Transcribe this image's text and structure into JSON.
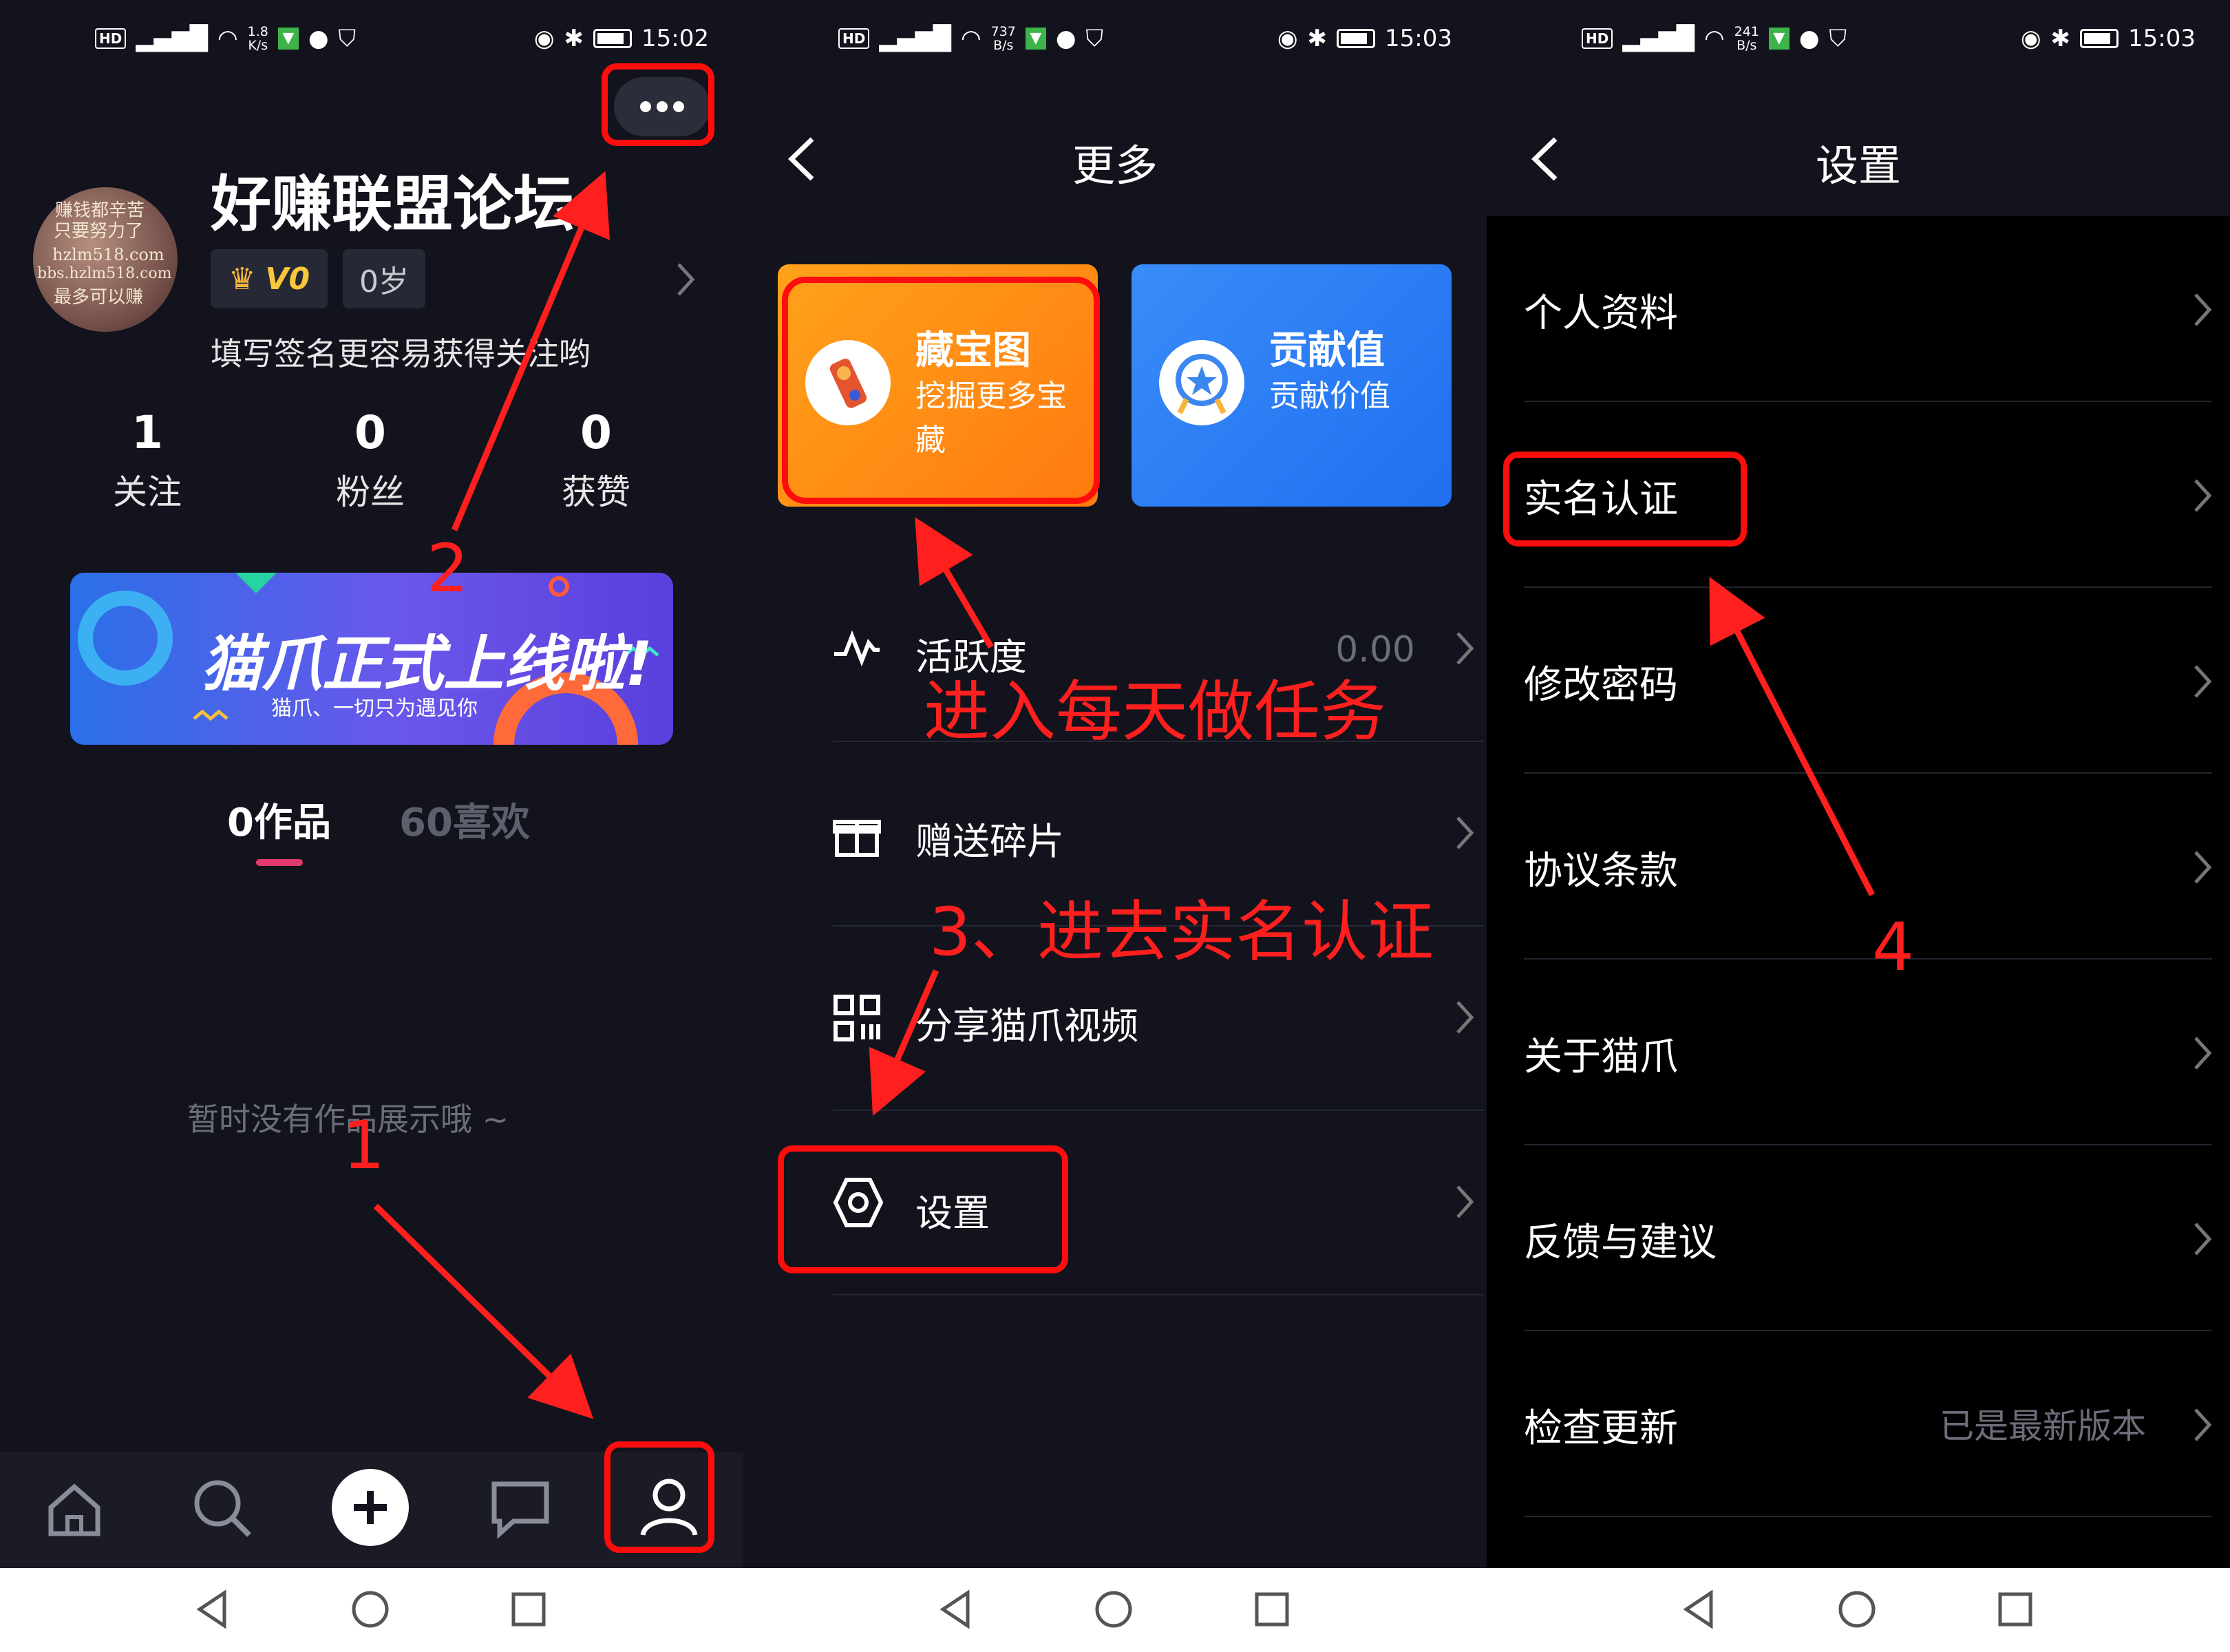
{
  "panel1": {
    "status": {
      "speed_top": "1.8",
      "speed_unit": "K/s",
      "time": "15:02"
    },
    "profile": {
      "name": "好赚联盟论坛",
      "level": "V0",
      "age": "0岁",
      "signature": "填写签名更容易获得关注哟",
      "avatar_text": [
        "赚钱都辛苦",
        "只要努力了",
        "hzlm518.com",
        "bbs.hzlm518.com",
        "最多可以赚"
      ]
    },
    "stats": [
      {
        "value": "1",
        "label": "关注"
      },
      {
        "value": "0",
        "label": "粉丝"
      },
      {
        "value": "0",
        "label": "获赞"
      }
    ],
    "banner": {
      "title": "猫爪正式上线啦!",
      "subtitle": "猫爪、一切只为遇见你"
    },
    "tabs": {
      "works": "0作品",
      "likes": "60喜欢"
    },
    "empty_text": "暂时没有作品展示哦 ~",
    "annotations": {
      "step1": "1",
      "step2": "2"
    }
  },
  "panel2": {
    "status": {
      "speed_top": "737",
      "speed_unit": "B/s",
      "time": "15:03"
    },
    "title": "更多",
    "cards": [
      {
        "title": "藏宝图",
        "subtitle": "挖掘更多宝藏"
      },
      {
        "title": "贡献值",
        "subtitle": "贡献价值"
      }
    ],
    "rows": [
      {
        "label": "活跃度",
        "value": "0.00"
      },
      {
        "label": "赠送碎片",
        "value": ""
      },
      {
        "label": "分享猫爪视频",
        "value": ""
      },
      {
        "label": "设置",
        "value": ""
      }
    ],
    "annotations": {
      "daily": "进入每天做任务",
      "step3": "3、进去实名认证"
    }
  },
  "panel3": {
    "status": {
      "speed_top": "241",
      "speed_unit": "B/s",
      "time": "15:03"
    },
    "title": "设置",
    "rows": [
      {
        "label": "个人资料",
        "value": ""
      },
      {
        "label": "实名认证",
        "value": ""
      },
      {
        "label": "修改密码",
        "value": ""
      },
      {
        "label": "协议条款",
        "value": ""
      },
      {
        "label": "关于猫爪",
        "value": ""
      },
      {
        "label": "反馈与建议",
        "value": ""
      },
      {
        "label": "检查更新",
        "value": "已是最新版本"
      }
    ],
    "annotations": {
      "step4": "4"
    }
  },
  "colors": {
    "accent_red": "#ff0d0d",
    "orange_card": "#ff8a12",
    "blue_card": "#2f7cf6",
    "tab_indicator": "#e23a6f"
  }
}
